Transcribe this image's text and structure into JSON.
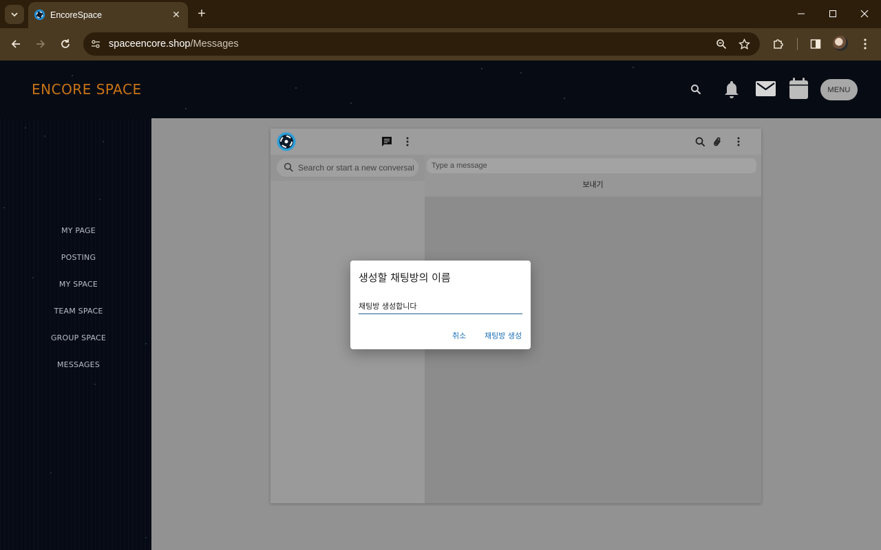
{
  "browser": {
    "tab_title": "EncoreSpace",
    "url_host": "spaceencore.shop",
    "url_path": "/Messages"
  },
  "site": {
    "logo": "ENCORE SPACE",
    "menu_label": "MENU",
    "sidebar": [
      {
        "label": "MY PAGE"
      },
      {
        "label": "POSTING"
      },
      {
        "label": "MY SPACE"
      },
      {
        "label": "TEAM SPACE"
      },
      {
        "label": "GROUP SPACE"
      },
      {
        "label": "MESSAGES"
      }
    ]
  },
  "chat": {
    "search_placeholder": "Search or start a new conversation",
    "message_placeholder": "Type a message",
    "send_label": "보내기"
  },
  "dialog": {
    "title": "생성할 채팅방의 이름",
    "input_value": "채팅방 생성합니다",
    "cancel_label": "취소",
    "create_label": "채팅방 생성"
  },
  "colors": {
    "logo": "#c87416",
    "dialog_accent": "#1b6fb5",
    "browser_frame": "#2d1e0b"
  }
}
